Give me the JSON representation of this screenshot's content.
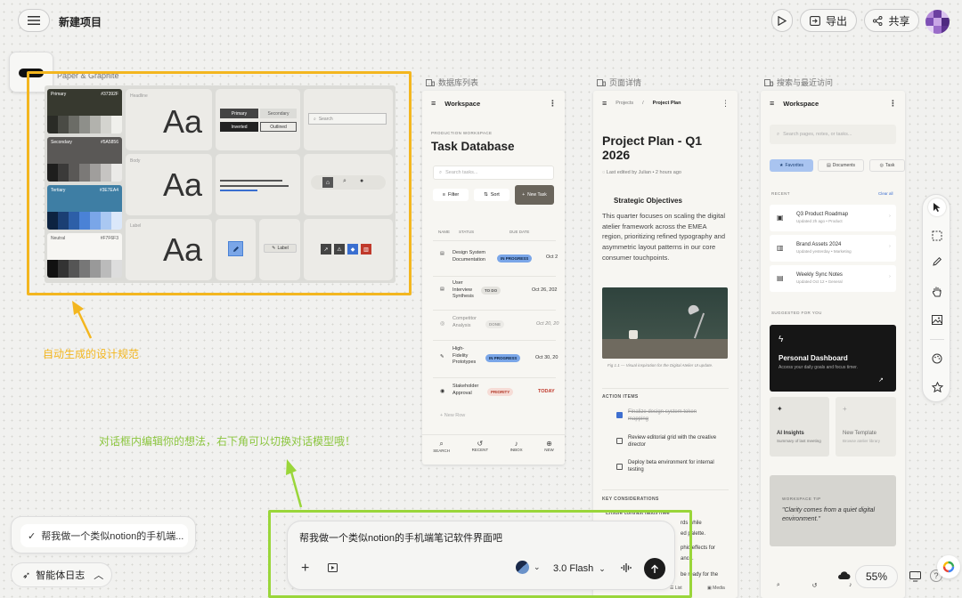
{
  "header": {
    "project_title": "新建项目",
    "export_label": "导出",
    "share_label": "共享"
  },
  "design_system": {
    "label": "Paper & Graphite",
    "swatches": [
      {
        "name": "Primary",
        "hex": "#37392F"
      },
      {
        "name": "Secondary",
        "hex": "#5A5856"
      },
      {
        "name": "Tertiary",
        "hex": "#3E7EA4"
      },
      {
        "name": "Neutral",
        "hex": "#F7F6F3"
      }
    ],
    "type_labels": [
      "Headline",
      "Body",
      "Label"
    ],
    "type_sample": "Aa",
    "buttons": {
      "primary": "Primary",
      "secondary": "Secondary",
      "inverted": "Inverted",
      "outlined": "Outlined"
    },
    "search_placeholder": "Search",
    "label_chip": "Label"
  },
  "database": {
    "section_label": "数据库列表",
    "workspace": "Workspace",
    "kicker": "PRODUCTION WORKSPACE",
    "title": "Task Database",
    "search_placeholder": "Search tasks...",
    "filter": "Filter",
    "sort": "Sort",
    "new_task": "New Task",
    "columns": [
      "NAME",
      "STATUS",
      "DUE DATE"
    ],
    "rows": [
      {
        "name": "Design System Documentation",
        "status": "IN PROGRESS",
        "due": "Oct 2"
      },
      {
        "name": "User Interview Synthesis",
        "status": "TO DO",
        "due": "Oct 26, 202"
      },
      {
        "name": "Competitor Analysis",
        "status": "DONE",
        "due": "Oct 20, 20"
      },
      {
        "name": "High-Fidelity Prototypes",
        "status": "IN PROGRESS",
        "due": "Oct 30, 20"
      },
      {
        "name": "Stakeholder Approval",
        "status": "PRIORITY",
        "due": "TODAY"
      }
    ],
    "new_row": "New Row",
    "nav": [
      "SEARCH",
      "RECENT",
      "INBOX",
      "NEW"
    ]
  },
  "page_detail": {
    "section_label": "页面详情",
    "crumb1": "Projects",
    "crumb2": "Project Plan",
    "title": "Project Plan - Q1 2026",
    "edited": "Last edited by Julian • 2 hours ago",
    "h_objectives": "Strategic Objectives",
    "body": "This quarter focuses on scaling the digital atelier framework across the EMEA region, prioritizing refined typography and asymmetric layout patterns in our core consumer touchpoints.",
    "caption": "Fig 1.1 — Visual inspiration for the Digital Atelier UI update.",
    "h_actions": "ACTION ITEMS",
    "actions": [
      {
        "text": "Finalize design system token mapping",
        "done": true
      },
      {
        "text": "Review editorial grid with the creative director",
        "done": false
      },
      {
        "text": "Deploy beta environment for internal testing",
        "done": false
      }
    ],
    "h_considerations": "KEY CONSIDERATIONS",
    "consideration": "Ensure contrast ratios mee",
    "bottom": [
      "Text",
      "List",
      "Media"
    ]
  },
  "search_recent": {
    "section_label": "搜索与最近访问",
    "workspace": "Workspace",
    "search_placeholder": "Search pages, notes, or tasks...",
    "chips": [
      "Favorites",
      "Documents",
      "Task"
    ],
    "recent": "RECENT",
    "clear_all": "Clear all",
    "items": [
      {
        "title": "Q3 Product Roadmap",
        "sub": "Updated 2h ago • Product"
      },
      {
        "title": "Brand Assets 2024",
        "sub": "Updated yesterday • Marketing"
      },
      {
        "title": "Weekly Sync Notes",
        "sub": "Updated Oct 12 • General"
      }
    ],
    "suggested": "SUGGESTED FOR YOU",
    "dash_title": "Personal Dashboard",
    "dash_sub": "Access your daily goals and focus timer.",
    "ai_title": "AI Insights",
    "ai_sub": "Summary of last meeting",
    "tpl_title": "New Template",
    "tpl_sub": "Browse atelier library",
    "tip_kicker": "WORKSPACE TIP",
    "tip_quote": "\"Clarity comes from a quiet digital environment.\""
  },
  "annotations": {
    "design_spec": "自动生成的设计规范",
    "chat_hint": "对话框内编辑你的想法，右下角可以切换对话模型哦！"
  },
  "chat": {
    "input_text": "帮我做一个类似notion的手机端笔记软件界面吧",
    "model": "3.0 Flash"
  },
  "left_panel": {
    "task_label": "帮我做一个类似notion的手机端...",
    "log_label": "智能体日志"
  },
  "zoom": "55%",
  "colors": {
    "highlight_yellow": "#f3b61f",
    "highlight_green": "#9ad63a",
    "accent_blue": "#3E7EA4"
  }
}
